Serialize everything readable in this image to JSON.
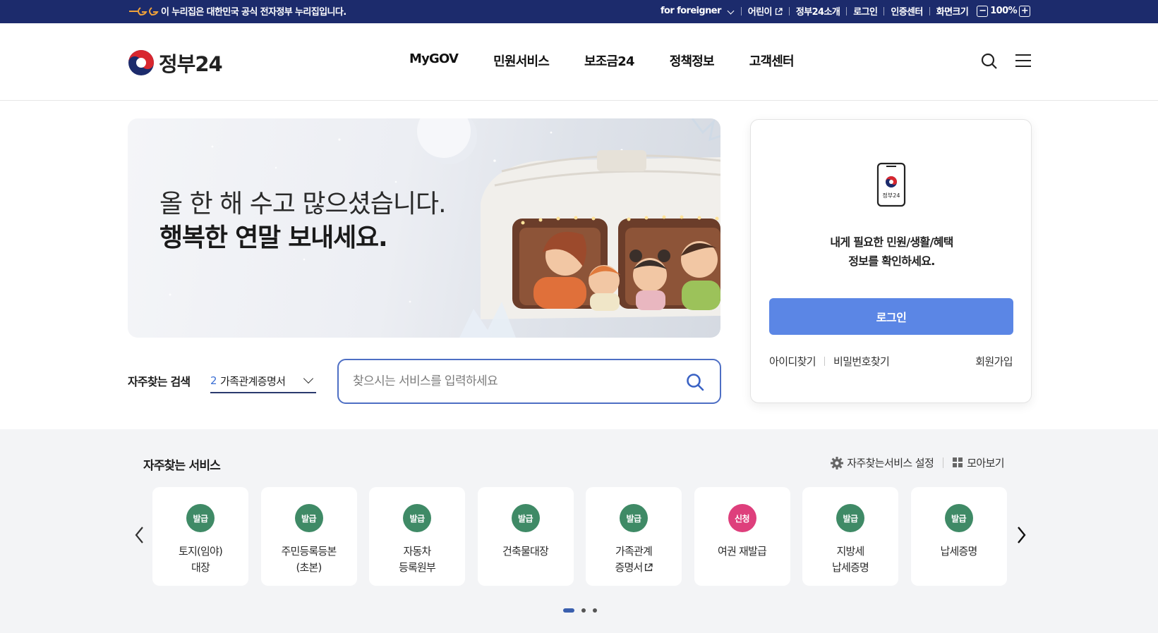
{
  "topbar": {
    "notice": "이 누리집은 대한민국 공식 전자정부 누리집입니다.",
    "links": [
      "for foreigner",
      "어린이",
      "정부24소개",
      "로그인",
      "인증센터",
      "화면크기"
    ],
    "zoom": "100%",
    "zoom_minus": "−",
    "zoom_plus": "+"
  },
  "header": {
    "logo_text": "정부24",
    "nav": [
      "MyGOV",
      "민원서비스",
      "보조금24",
      "정책정보",
      "고객센터"
    ]
  },
  "hero": {
    "line1": "올 한 해 수고 많으셨습니다.",
    "line2": "행복한 연말 보내세요."
  },
  "quick_search": {
    "label": "자주찾는 검색",
    "rank": "2",
    "term": "가족관계증명서",
    "placeholder": "찾으시는 서비스를 입력하세요"
  },
  "login": {
    "message_line1": "내게 필요한 민원/생활/혜택",
    "message_line2": "정보를 확인하세요.",
    "phone_caption": "정부24",
    "button": "로그인",
    "find_id": "아이디찾기",
    "find_pw": "비밀번호찾기",
    "signup": "회원가입"
  },
  "favorites": {
    "title": "자주찾는 서비스",
    "settings": "자주찾는서비스 설정",
    "view_all": "모아보기",
    "cards": [
      {
        "badge": "발급",
        "label": "토지(임야)\n대장"
      },
      {
        "badge": "발급",
        "label": "주민등록등본\n(초본)"
      },
      {
        "badge": "발급",
        "label": "자동차\n등록원부"
      },
      {
        "badge": "발급",
        "label": "건축물대장"
      },
      {
        "badge": "발급",
        "label": "가족관계\n증명서"
      },
      {
        "badge": "신청",
        "label": "여권 재발급"
      },
      {
        "badge": "발급",
        "label": "지방세\n납세증명"
      },
      {
        "badge": "발급",
        "label": "납세증명"
      }
    ]
  },
  "colors": {
    "topbar": "#1c2b6c",
    "login_button": "#5b86e5",
    "badge_issue": "#3f8a66",
    "badge_apply": "#de3f7c",
    "search_border": "#4e6fc4"
  }
}
